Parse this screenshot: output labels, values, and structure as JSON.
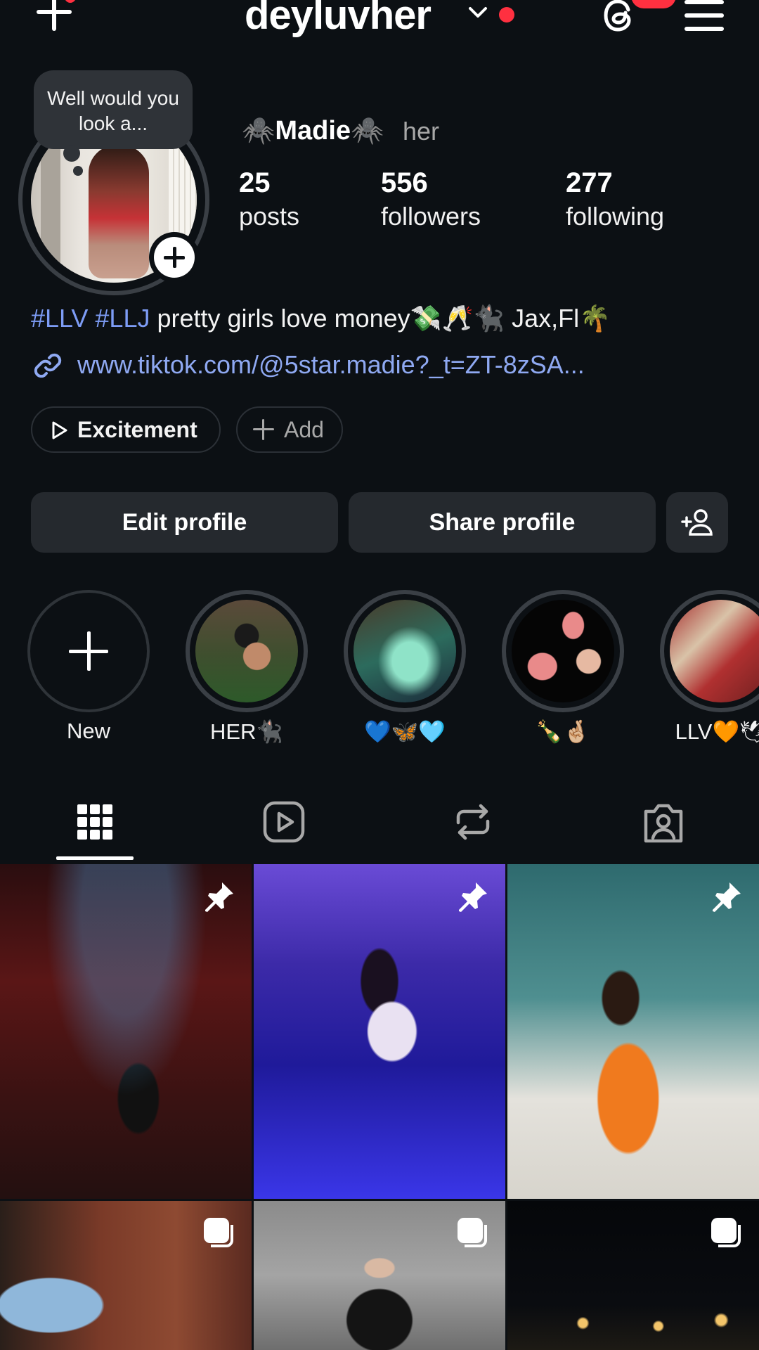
{
  "header": {
    "username": "deyluvher"
  },
  "profile": {
    "note": "Well would you look a...",
    "display_name": "🕷️Madie🕷️",
    "pronouns": "her",
    "stats": [
      {
        "value": "25",
        "label": "posts"
      },
      {
        "value": "556",
        "label": "followers"
      },
      {
        "value": "277",
        "label": "following"
      }
    ],
    "bio_tags": "#LLV #LLJ",
    "bio_text": " pretty girls love money💸🥂🐈‍⬛ Jax,Fl🌴",
    "link": "www.tiktok.com/@5star.madie?_t=ZT-8zSA..."
  },
  "chips": {
    "excitement": "Excitement",
    "add": "Add"
  },
  "actions": {
    "edit": "Edit profile",
    "share": "Share profile"
  },
  "highlights": [
    {
      "label": "New"
    },
    {
      "label": "HER🐈‍⬛"
    },
    {
      "label": "💙🦋🩵"
    },
    {
      "label": "🍾🤞🏼"
    },
    {
      "label": "LLV🧡🕊"
    }
  ],
  "tabs": [
    "grid-icon",
    "reels-icon",
    "reposts-icon",
    "tagged-icon"
  ],
  "colors": {
    "background": "#0c1014",
    "link": "#7d9cf5",
    "notification": "#ff3040",
    "button": "#25292e"
  }
}
